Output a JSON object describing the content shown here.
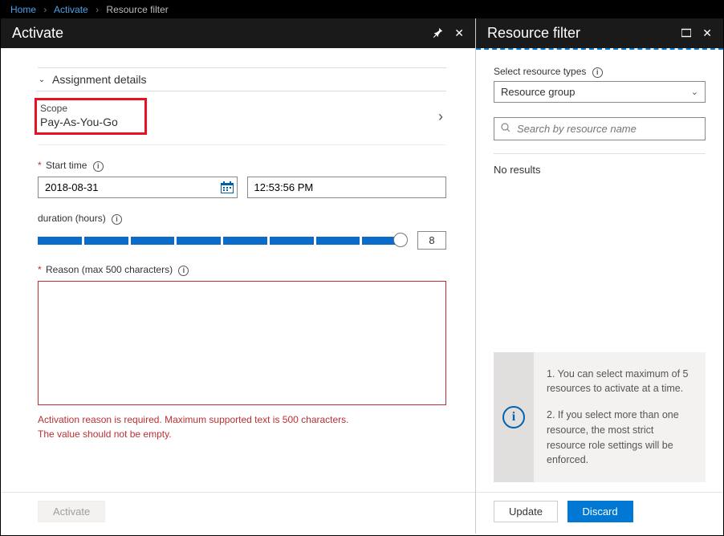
{
  "breadcrumb": {
    "home": "Home",
    "activate": "Activate",
    "current": "Resource filter"
  },
  "left": {
    "title": "Activate",
    "section": {
      "header": "Assignment details",
      "scope_label": "Scope",
      "scope_value": "Pay-As-You-Go",
      "start_time_label": "Start time",
      "date_value": "2018-08-31",
      "time_value": "12:53:56 PM",
      "duration_label": "duration (hours)",
      "duration_value": "8",
      "duration_ticks_total": 8,
      "duration_ticks_filled": 8,
      "reason_label": "Reason (max 500 characters)",
      "reason_value": "",
      "error_line1": "Activation reason is required. Maximum supported text is 500 characters.",
      "error_line2": "The value should not be empty."
    },
    "footer": {
      "activate": "Activate"
    }
  },
  "right": {
    "title": "Resource filter",
    "types_label": "Select resource types",
    "types_value": "Resource group",
    "search_placeholder": "Search by resource name",
    "no_results": "No results",
    "info1": "1. You can select maximum of 5 resources to activate at a time.",
    "info2": "2. If you select more than one resource, the most strict resource role settings will be enforced.",
    "footer": {
      "update": "Update",
      "discard": "Discard"
    }
  }
}
